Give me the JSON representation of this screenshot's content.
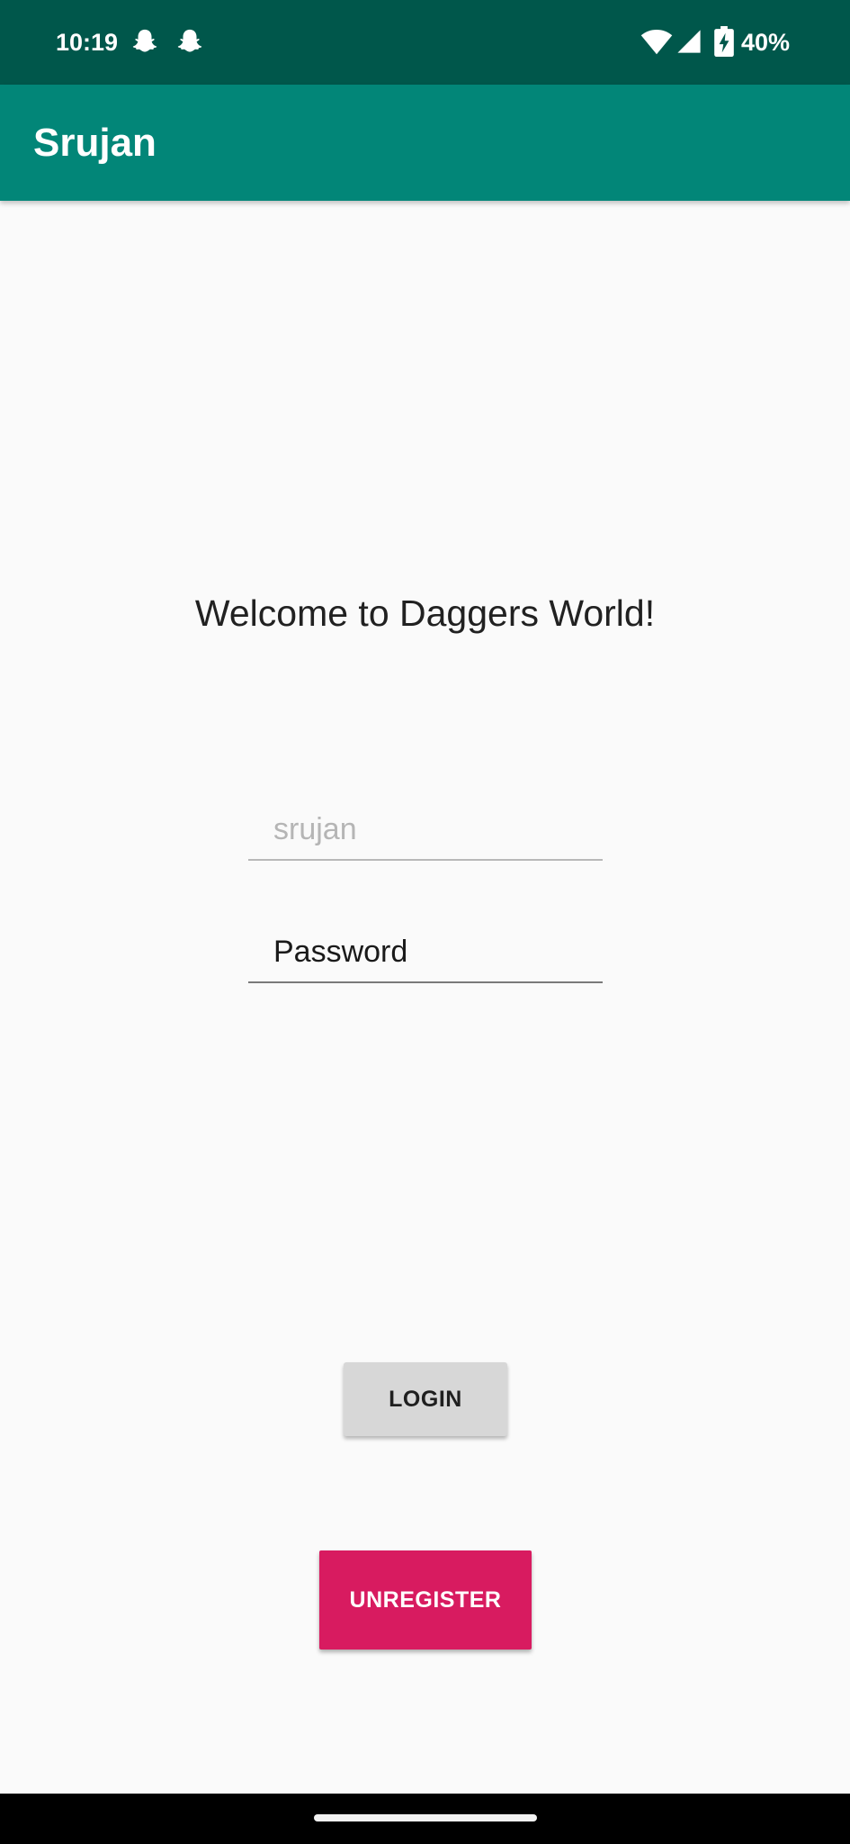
{
  "status_bar": {
    "time": "10:19",
    "battery": "40%",
    "icons": [
      "snapchat-ghost-icon",
      "snapchat-ghost-icon",
      "wifi-icon",
      "cellular-signal-icon",
      "battery-charging-icon"
    ]
  },
  "app_bar": {
    "title": "Srujan"
  },
  "main": {
    "welcome": "Welcome to Daggers World!",
    "username": {
      "placeholder": "srujan",
      "value": ""
    },
    "password": {
      "placeholder": "Password",
      "value": ""
    },
    "login_label": "LOGIN",
    "unregister_label": "UNREGISTER"
  },
  "colors": {
    "status_bar": "#00574b",
    "app_bar": "#028678",
    "background": "#fafafa",
    "login_button": "#d7d7d7",
    "unregister_button": "#d81b60"
  }
}
